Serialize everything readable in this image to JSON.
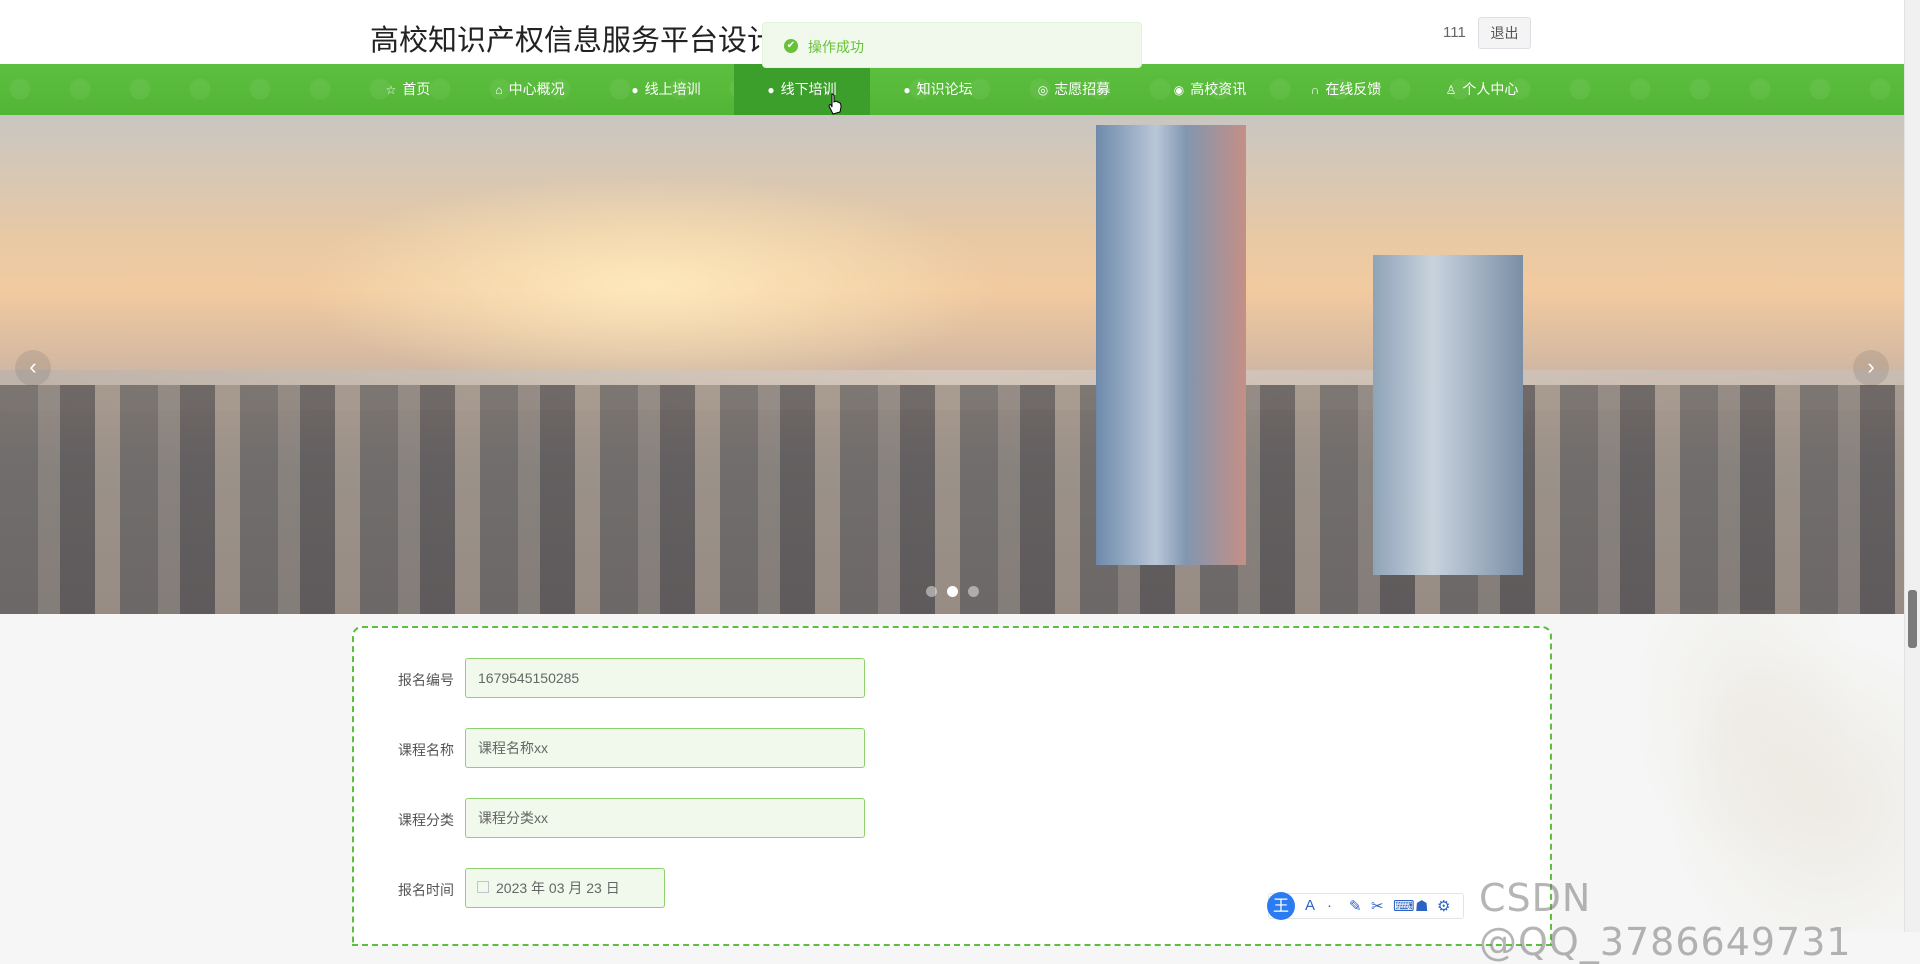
{
  "header": {
    "title": "高校知识产权信息服务平台设计",
    "toast": "操作成功",
    "username": "111",
    "logout_label": "退出"
  },
  "nav": {
    "items": [
      {
        "icon": "☆",
        "label": "首页"
      },
      {
        "icon": "⌂",
        "label": "中心概况"
      },
      {
        "icon": "●",
        "label": "线上培训"
      },
      {
        "icon": "●",
        "label": "线下培训"
      },
      {
        "icon": "●",
        "label": "知识论坛"
      },
      {
        "icon": "◎",
        "label": "志愿招募"
      },
      {
        "icon": "◉",
        "label": "高校资讯"
      },
      {
        "icon": "∩",
        "label": "在线反馈"
      },
      {
        "icon": "♙",
        "label": "个人中心"
      }
    ]
  },
  "banner": {
    "prev_symbol": "‹",
    "next_symbol": "›",
    "active_slide": 2,
    "slide_count": 3
  },
  "form": {
    "fields": [
      {
        "label": "报名编号",
        "value": "1679545150285"
      },
      {
        "label": "课程名称",
        "value": "课程名称xx"
      },
      {
        "label": "课程分类",
        "value": "课程分类xx"
      },
      {
        "label": "报名时间",
        "value": "2023 年 03 月 23 日"
      }
    ]
  },
  "ime": {
    "logo": "王",
    "tools": [
      "A",
      "·",
      "✎",
      "✂",
      "⌨",
      "☗",
      "⚙"
    ]
  },
  "watermark": "CSDN @QQ_3786649731",
  "colors": {
    "nav_green": "#53b536",
    "nav_active": "#3d9f2b",
    "success": "#67c23a",
    "field_bg": "#f0f9eb"
  }
}
